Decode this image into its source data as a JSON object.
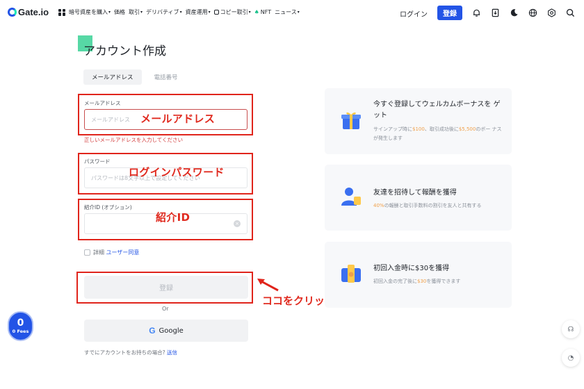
{
  "header": {
    "logo_text": "Gate.io",
    "nav": [
      {
        "label": "暗号資産を購入",
        "caret": "▾"
      },
      {
        "label": "価格",
        "caret": ""
      },
      {
        "label": "取引",
        "caret": "▾"
      },
      {
        "label": "デリバティブ",
        "caret": "▾"
      },
      {
        "label": "資産運用",
        "caret": "▾"
      },
      {
        "label": "コピー取引",
        "caret": "▾"
      },
      {
        "label": "NFT",
        "caret": ""
      },
      {
        "label": "ニュース",
        "caret": "▾"
      }
    ],
    "login_label": "ログイン",
    "register_label": "登録",
    "icons": [
      "bell-icon",
      "download-icon",
      "theme-icon",
      "globe-icon",
      "settings-hex-icon",
      "search-icon"
    ]
  },
  "form": {
    "title": "アカウント作成",
    "tabs": [
      {
        "label": "メールアドレス",
        "active": true
      },
      {
        "label": "電話番号",
        "active": false
      }
    ],
    "email": {
      "label": "メールアドレス",
      "placeholder": "メールアドレス",
      "error": "正しいメールアドレスを入力してください"
    },
    "password": {
      "label": "パスワード",
      "placeholder": "パスワードは8文字以上で設定してください"
    },
    "referral": {
      "label": "紹介ID (オプション)",
      "placeholder": ""
    },
    "agree_prefix": "詳細",
    "agree_link": "ユーザー同意",
    "submit_label": "登録",
    "or_label": "Or",
    "google_g": "G",
    "google_label": "Google",
    "already_text": "すでにアカウントをお持ちの場合?",
    "already_link": "送信"
  },
  "annotations": {
    "email_label": "メールアドレス",
    "password_label": "ログインパスワード",
    "referral_label": "紹介ID",
    "click_label": "ココをクリック",
    "color": "#e0241b"
  },
  "cards": [
    {
      "icon": "gift-icon",
      "title": "今すぐ登録してウェルカムボーナスを ゲット",
      "desc_parts": [
        "サインアップ時に",
        "$100",
        "、取引成功後に",
        "$5,500",
        "のボー ナスが発生します"
      ]
    },
    {
      "icon": "referral-user-icon",
      "title": "友達を招待して報酬を獲得",
      "desc_parts": [
        "",
        "40%",
        "の報酬と取引手数料の割引を友人と共有する",
        "",
        ""
      ]
    },
    {
      "icon": "wallet-icon",
      "title": "初回入金時に$30を獲得",
      "desc_parts": [
        "初回入金の完了後に",
        "$30",
        "を獲得できます",
        "",
        ""
      ]
    }
  ],
  "fees_badge": {
    "value": "0",
    "label": "0 Fees"
  },
  "colors": {
    "brand": "#2354e6",
    "accent_green": "#17e7b6",
    "highlight": "#f0a04a"
  }
}
